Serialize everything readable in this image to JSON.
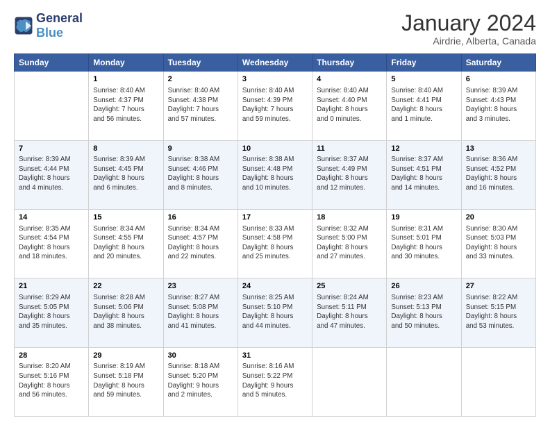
{
  "logo": {
    "line1": "General",
    "line2": "Blue"
  },
  "title": "January 2024",
  "subtitle": "Airdrie, Alberta, Canada",
  "days_of_week": [
    "Sunday",
    "Monday",
    "Tuesday",
    "Wednesday",
    "Thursday",
    "Friday",
    "Saturday"
  ],
  "weeks": [
    [
      {
        "num": "",
        "info": ""
      },
      {
        "num": "1",
        "info": "Sunrise: 8:40 AM\nSunset: 4:37 PM\nDaylight: 7 hours\nand 56 minutes."
      },
      {
        "num": "2",
        "info": "Sunrise: 8:40 AM\nSunset: 4:38 PM\nDaylight: 7 hours\nand 57 minutes."
      },
      {
        "num": "3",
        "info": "Sunrise: 8:40 AM\nSunset: 4:39 PM\nDaylight: 7 hours\nand 59 minutes."
      },
      {
        "num": "4",
        "info": "Sunrise: 8:40 AM\nSunset: 4:40 PM\nDaylight: 8 hours\nand 0 minutes."
      },
      {
        "num": "5",
        "info": "Sunrise: 8:40 AM\nSunset: 4:41 PM\nDaylight: 8 hours\nand 1 minute."
      },
      {
        "num": "6",
        "info": "Sunrise: 8:39 AM\nSunset: 4:43 PM\nDaylight: 8 hours\nand 3 minutes."
      }
    ],
    [
      {
        "num": "7",
        "info": "Sunrise: 8:39 AM\nSunset: 4:44 PM\nDaylight: 8 hours\nand 4 minutes."
      },
      {
        "num": "8",
        "info": "Sunrise: 8:39 AM\nSunset: 4:45 PM\nDaylight: 8 hours\nand 6 minutes."
      },
      {
        "num": "9",
        "info": "Sunrise: 8:38 AM\nSunset: 4:46 PM\nDaylight: 8 hours\nand 8 minutes."
      },
      {
        "num": "10",
        "info": "Sunrise: 8:38 AM\nSunset: 4:48 PM\nDaylight: 8 hours\nand 10 minutes."
      },
      {
        "num": "11",
        "info": "Sunrise: 8:37 AM\nSunset: 4:49 PM\nDaylight: 8 hours\nand 12 minutes."
      },
      {
        "num": "12",
        "info": "Sunrise: 8:37 AM\nSunset: 4:51 PM\nDaylight: 8 hours\nand 14 minutes."
      },
      {
        "num": "13",
        "info": "Sunrise: 8:36 AM\nSunset: 4:52 PM\nDaylight: 8 hours\nand 16 minutes."
      }
    ],
    [
      {
        "num": "14",
        "info": "Sunrise: 8:35 AM\nSunset: 4:54 PM\nDaylight: 8 hours\nand 18 minutes."
      },
      {
        "num": "15",
        "info": "Sunrise: 8:34 AM\nSunset: 4:55 PM\nDaylight: 8 hours\nand 20 minutes."
      },
      {
        "num": "16",
        "info": "Sunrise: 8:34 AM\nSunset: 4:57 PM\nDaylight: 8 hours\nand 22 minutes."
      },
      {
        "num": "17",
        "info": "Sunrise: 8:33 AM\nSunset: 4:58 PM\nDaylight: 8 hours\nand 25 minutes."
      },
      {
        "num": "18",
        "info": "Sunrise: 8:32 AM\nSunset: 5:00 PM\nDaylight: 8 hours\nand 27 minutes."
      },
      {
        "num": "19",
        "info": "Sunrise: 8:31 AM\nSunset: 5:01 PM\nDaylight: 8 hours\nand 30 minutes."
      },
      {
        "num": "20",
        "info": "Sunrise: 8:30 AM\nSunset: 5:03 PM\nDaylight: 8 hours\nand 33 minutes."
      }
    ],
    [
      {
        "num": "21",
        "info": "Sunrise: 8:29 AM\nSunset: 5:05 PM\nDaylight: 8 hours\nand 35 minutes."
      },
      {
        "num": "22",
        "info": "Sunrise: 8:28 AM\nSunset: 5:06 PM\nDaylight: 8 hours\nand 38 minutes."
      },
      {
        "num": "23",
        "info": "Sunrise: 8:27 AM\nSunset: 5:08 PM\nDaylight: 8 hours\nand 41 minutes."
      },
      {
        "num": "24",
        "info": "Sunrise: 8:25 AM\nSunset: 5:10 PM\nDaylight: 8 hours\nand 44 minutes."
      },
      {
        "num": "25",
        "info": "Sunrise: 8:24 AM\nSunset: 5:11 PM\nDaylight: 8 hours\nand 47 minutes."
      },
      {
        "num": "26",
        "info": "Sunrise: 8:23 AM\nSunset: 5:13 PM\nDaylight: 8 hours\nand 50 minutes."
      },
      {
        "num": "27",
        "info": "Sunrise: 8:22 AM\nSunset: 5:15 PM\nDaylight: 8 hours\nand 53 minutes."
      }
    ],
    [
      {
        "num": "28",
        "info": "Sunrise: 8:20 AM\nSunset: 5:16 PM\nDaylight: 8 hours\nand 56 minutes."
      },
      {
        "num": "29",
        "info": "Sunrise: 8:19 AM\nSunset: 5:18 PM\nDaylight: 8 hours\nand 59 minutes."
      },
      {
        "num": "30",
        "info": "Sunrise: 8:18 AM\nSunset: 5:20 PM\nDaylight: 9 hours\nand 2 minutes."
      },
      {
        "num": "31",
        "info": "Sunrise: 8:16 AM\nSunset: 5:22 PM\nDaylight: 9 hours\nand 5 minutes."
      },
      {
        "num": "",
        "info": ""
      },
      {
        "num": "",
        "info": ""
      },
      {
        "num": "",
        "info": ""
      }
    ]
  ]
}
